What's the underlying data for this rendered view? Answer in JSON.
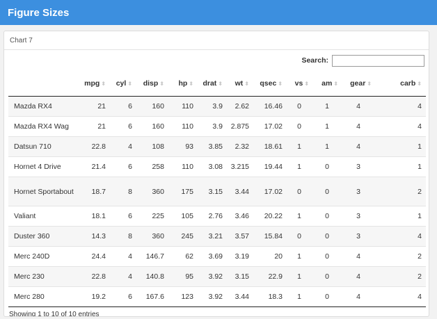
{
  "navbar": {
    "title": "Figure Sizes"
  },
  "card": {
    "header": "Chart 7"
  },
  "search": {
    "label": "Search:",
    "value": ""
  },
  "table": {
    "columns": [
      "",
      "mpg",
      "cyl",
      "disp",
      "hp",
      "drat",
      "wt",
      "qsec",
      "vs",
      "am",
      "gear",
      "carb"
    ],
    "rows": [
      [
        "Mazda RX4",
        "21",
        "6",
        "160",
        "110",
        "3.9",
        "2.62",
        "16.46",
        "0",
        "1",
        "4",
        "4"
      ],
      [
        "Mazda RX4 Wag",
        "21",
        "6",
        "160",
        "110",
        "3.9",
        "2.875",
        "17.02",
        "0",
        "1",
        "4",
        "4"
      ],
      [
        "Datsun 710",
        "22.8",
        "4",
        "108",
        "93",
        "3.85",
        "2.32",
        "18.61",
        "1",
        "1",
        "4",
        "1"
      ],
      [
        "Hornet 4 Drive",
        "21.4",
        "6",
        "258",
        "110",
        "3.08",
        "3.215",
        "19.44",
        "1",
        "0",
        "3",
        "1"
      ],
      [
        "Hornet Sportabout",
        "18.7",
        "8",
        "360",
        "175",
        "3.15",
        "3.44",
        "17.02",
        "0",
        "0",
        "3",
        "2"
      ],
      [
        "Valiant",
        "18.1",
        "6",
        "225",
        "105",
        "2.76",
        "3.46",
        "20.22",
        "1",
        "0",
        "3",
        "1"
      ],
      [
        "Duster 360",
        "14.3",
        "8",
        "360",
        "245",
        "3.21",
        "3.57",
        "15.84",
        "0",
        "0",
        "3",
        "4"
      ],
      [
        "Merc 240D",
        "24.4",
        "4",
        "146.7",
        "62",
        "3.69",
        "3.19",
        "20",
        "1",
        "0",
        "4",
        "2"
      ],
      [
        "Merc 230",
        "22.8",
        "4",
        "140.8",
        "95",
        "3.92",
        "3.15",
        "22.9",
        "1",
        "0",
        "4",
        "2"
      ],
      [
        "Merc 280",
        "19.2",
        "6",
        "167.6",
        "123",
        "3.92",
        "3.44",
        "18.3",
        "1",
        "0",
        "4",
        "4"
      ]
    ]
  },
  "info": "Showing 1 to 10 of 10 entries",
  "colors": {
    "navbar": "#3c8fdf"
  }
}
